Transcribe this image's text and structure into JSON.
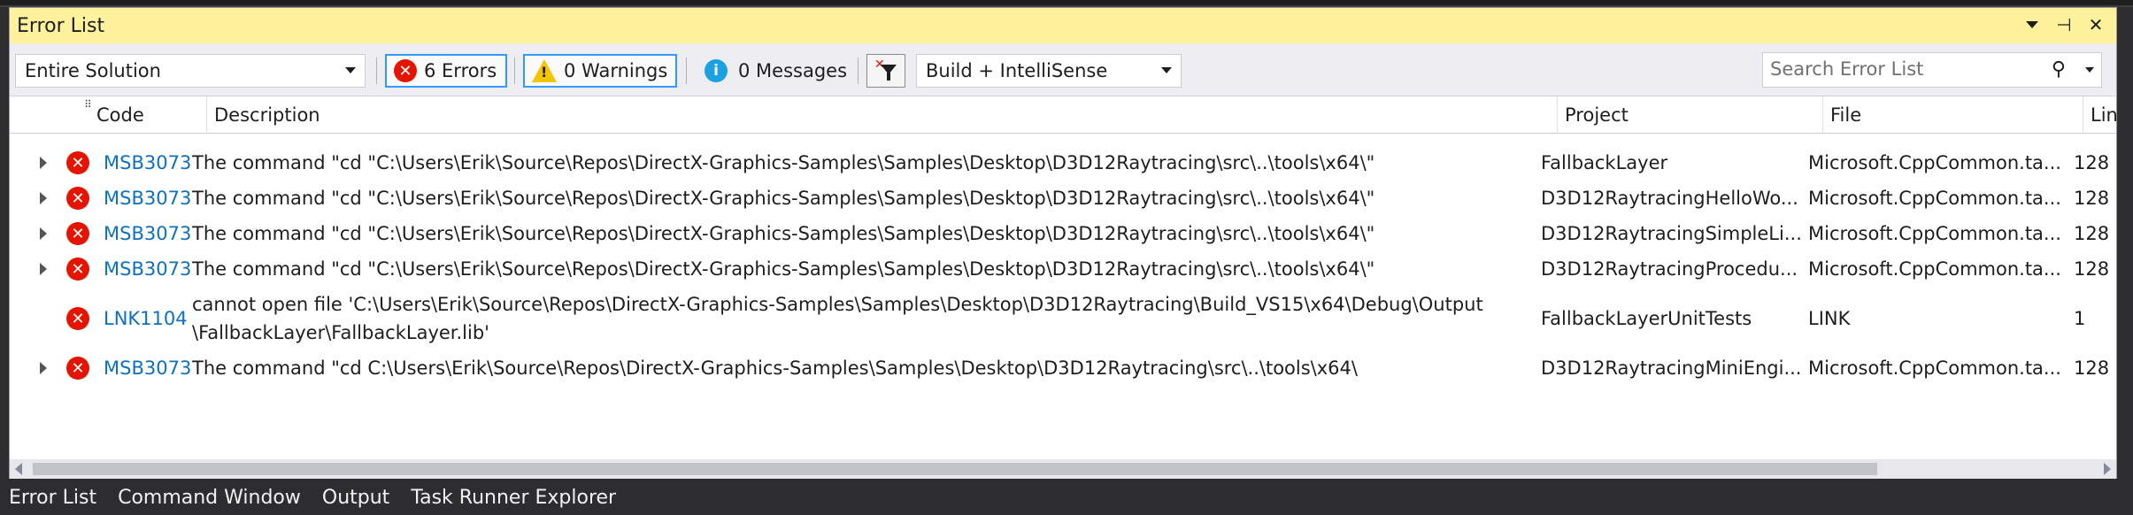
{
  "window": {
    "title": "Error List"
  },
  "toolbar": {
    "scope": "Entire Solution",
    "errors_label": "6 Errors",
    "warnings_label": "0 Warnings",
    "messages_label": "0 Messages",
    "build_source": "Build + IntelliSense",
    "search_placeholder": "Search Error List"
  },
  "columns": {
    "code": "Code",
    "description": "Description",
    "project": "Project",
    "file": "File",
    "line": "Line"
  },
  "rows": [
    {
      "expandable": true,
      "code": "MSB3073",
      "description": "The command \"cd \"C:\\Users\\Erik\\Source\\Repos\\DirectX-Graphics-Samples\\Samples\\Desktop\\D3D12Raytracing\\src\\..\\tools\\x64\\\"",
      "project": "FallbackLayer",
      "file": "Microsoft.CppCommon.ta...",
      "line": "128"
    },
    {
      "expandable": true,
      "code": "MSB3073",
      "description": "The command \"cd \"C:\\Users\\Erik\\Source\\Repos\\DirectX-Graphics-Samples\\Samples\\Desktop\\D3D12Raytracing\\src\\..\\tools\\x64\\\"",
      "project": "D3D12RaytracingHelloWo...",
      "file": "Microsoft.CppCommon.ta...",
      "line": "128"
    },
    {
      "expandable": true,
      "code": "MSB3073",
      "description": "The command \"cd \"C:\\Users\\Erik\\Source\\Repos\\DirectX-Graphics-Samples\\Samples\\Desktop\\D3D12Raytracing\\src\\..\\tools\\x64\\\"",
      "project": "D3D12RaytracingSimpleLi...",
      "file": "Microsoft.CppCommon.ta...",
      "line": "128"
    },
    {
      "expandable": true,
      "code": "MSB3073",
      "description": "The command \"cd \"C:\\Users\\Erik\\Source\\Repos\\DirectX-Graphics-Samples\\Samples\\Desktop\\D3D12Raytracing\\src\\..\\tools\\x64\\\"",
      "project": "D3D12RaytracingProcedu...",
      "file": "Microsoft.CppCommon.ta...",
      "line": "128"
    },
    {
      "expandable": false,
      "code": "LNK1104",
      "description": "cannot open file 'C:\\Users\\Erik\\Source\\Repos\\DirectX-Graphics-Samples\\Samples\\Desktop\\D3D12Raytracing\\Build_VS15\\x64\\Debug\\Output \\FallbackLayer\\FallbackLayer.lib'",
      "project": "FallbackLayerUnitTests",
      "file": "LINK",
      "line": "1"
    },
    {
      "expandable": true,
      "code": "MSB3073",
      "description": "The command \"cd C:\\Users\\Erik\\Source\\Repos\\DirectX-Graphics-Samples\\Samples\\Desktop\\D3D12Raytracing\\src\\..\\tools\\x64\\",
      "project": "D3D12RaytracingMiniEngi...",
      "file": "Microsoft.CppCommon.ta...",
      "line": "128"
    }
  ],
  "bottom_tabs": [
    "Error List",
    "Command Window",
    "Output",
    "Task Runner Explorer"
  ],
  "colors": {
    "title_bar": "#fff29d",
    "error": "#e51400",
    "warning": "#f2c500",
    "info": "#1ba1e2",
    "link": "#0e70c0",
    "selected_border": "#3399ff"
  },
  "icons": [
    "error-icon",
    "warning-icon",
    "info-icon",
    "filter-icon",
    "search-icon",
    "pin-icon",
    "close-icon",
    "dropdown-icon",
    "expand-icon"
  ]
}
